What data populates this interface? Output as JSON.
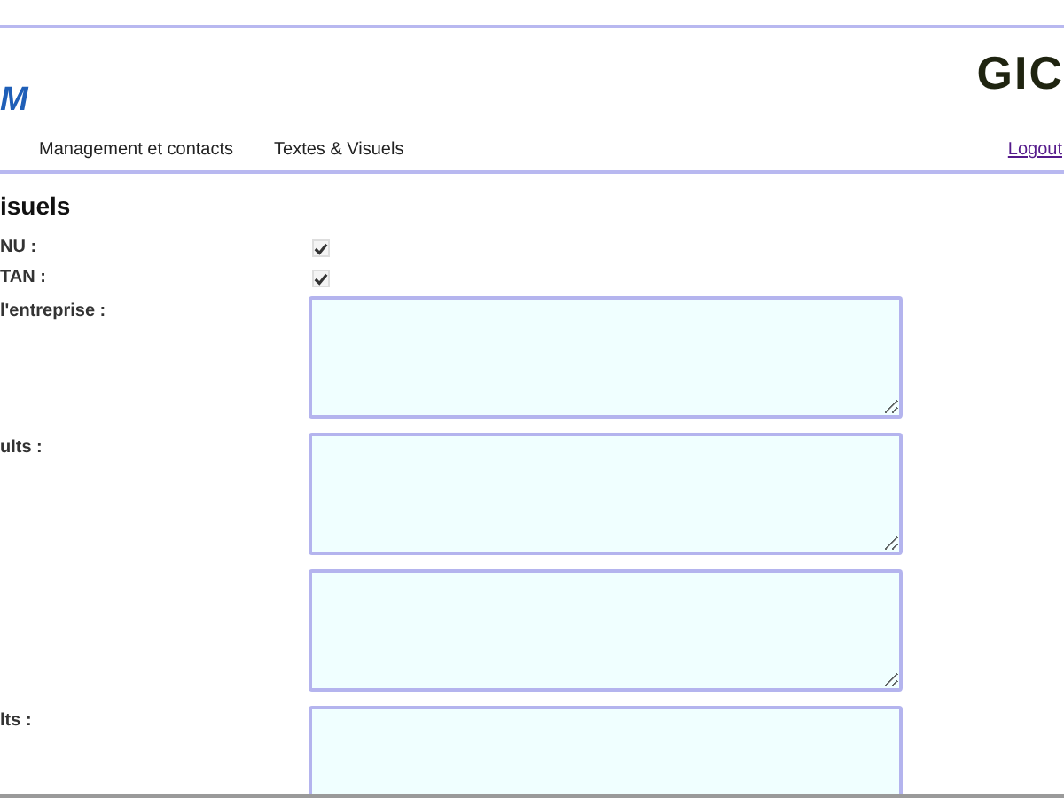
{
  "header": {
    "title": "M",
    "logo": "GIC",
    "nav": [
      "Management et contacts",
      "Textes & Visuels"
    ],
    "logout": "Logout"
  },
  "section": {
    "heading": "isuels"
  },
  "fields": [
    {
      "kind": "checkbox",
      "label": "NU :",
      "checked": true
    },
    {
      "kind": "checkbox",
      "label": "TAN :",
      "checked": true
    },
    {
      "kind": "textarea",
      "label": "l'entreprise :"
    },
    {
      "kind": "textarea",
      "label": "ults :"
    },
    {
      "kind": "textarea"
    },
    {
      "kind": "textarea",
      "label": "lts :"
    }
  ]
}
